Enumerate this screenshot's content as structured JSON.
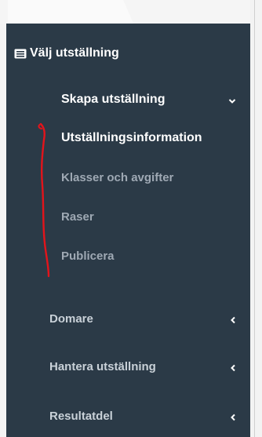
{
  "sidebar": {
    "header": {
      "label": "Välj utställning",
      "icon": "list-card-icon"
    },
    "submenu": {
      "label": "Skapa utställning",
      "chevron": "chevron-down-icon",
      "items": [
        {
          "label": "Utställningsinformation",
          "active": true
        },
        {
          "label": "Klasser och avgifter",
          "active": false
        },
        {
          "label": "Raser",
          "active": false
        },
        {
          "label": "Publicera",
          "active": false
        }
      ]
    },
    "sections": [
      {
        "label": "Domare",
        "chevron": "chevron-left-icon"
      },
      {
        "label": "Hantera utställning",
        "chevron": "chevron-left-icon"
      },
      {
        "label": "Resultatdel",
        "chevron": "chevron-left-icon"
      }
    ]
  },
  "colors": {
    "sidebar_bg": "#2b3a47",
    "active_text": "#ffffff",
    "muted_text": "#9fa9b4",
    "annotation_red": "#e3141b"
  }
}
